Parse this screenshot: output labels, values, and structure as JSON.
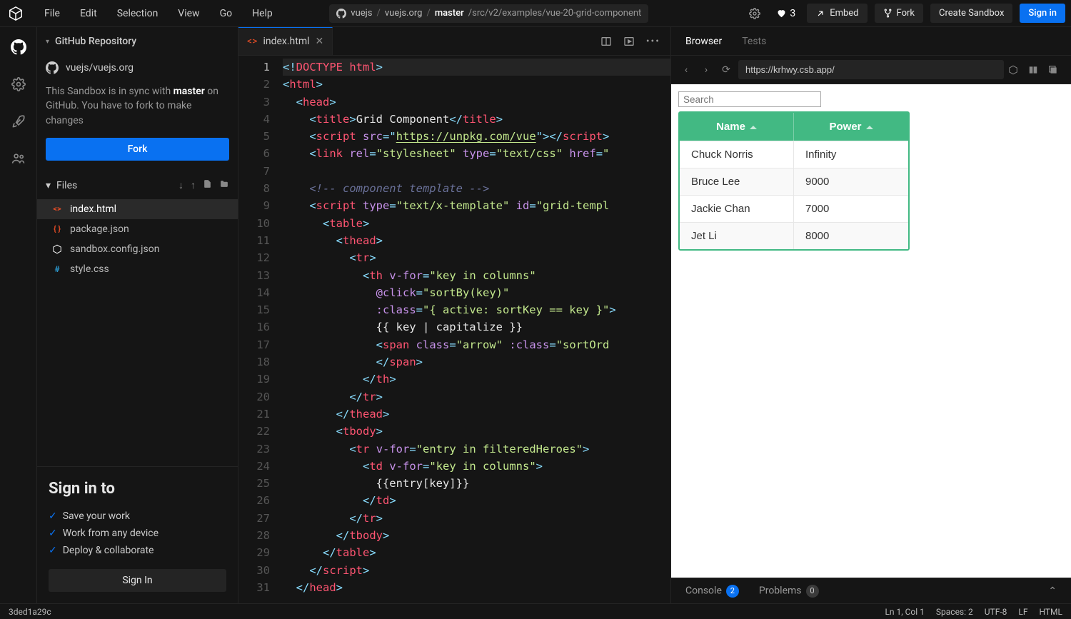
{
  "menubar": {
    "menus": [
      "File",
      "Edit",
      "Selection",
      "View",
      "Go",
      "Help"
    ],
    "breadcrumb": {
      "owner": "vuejs",
      "repo": "vuejs.org",
      "branch": "master",
      "path": "/src/v2/examples/vue-20-grid-component"
    },
    "likes": "3",
    "embed": "Embed",
    "fork": "Fork",
    "create": "Create Sandbox",
    "signin": "Sign in"
  },
  "sidebar": {
    "title": "GitHub Repository",
    "repo": "vuejs/vuejs.org",
    "sync_msg_pre": "This Sandbox is in sync with ",
    "sync_msg_bold": "master",
    "sync_msg_post": " on GitHub. You have to fork to make changes",
    "fork": "Fork",
    "files_title": "Files",
    "files": [
      {
        "name": "index.html",
        "icon": "orange",
        "active": true
      },
      {
        "name": "package.json",
        "icon": "json",
        "active": false
      },
      {
        "name": "sandbox.config.json",
        "icon": "cfg",
        "active": false
      },
      {
        "name": "style.css",
        "icon": "css",
        "active": false
      }
    ],
    "signin": {
      "title": "Sign in to",
      "benefits": [
        "Save your work",
        "Work from any device",
        "Deploy & collaborate"
      ],
      "button": "Sign In"
    }
  },
  "tabs": {
    "active": "index.html"
  },
  "editor": {
    "lines": 31
  },
  "preview": {
    "tabs": [
      "Browser",
      "Tests"
    ],
    "url": "https://krhwy.csb.app/",
    "search_placeholder": "Search",
    "table": {
      "headers": [
        "Name",
        "Power"
      ],
      "rows": [
        {
          "name": "Chuck Norris",
          "power": "Infinity"
        },
        {
          "name": "Bruce Lee",
          "power": "9000"
        },
        {
          "name": "Jackie Chan",
          "power": "7000"
        },
        {
          "name": "Jet Li",
          "power": "8000"
        }
      ]
    },
    "console_label": "Console",
    "console_badge": "2",
    "problems_label": "Problems",
    "problems_badge": "0"
  },
  "statusbar": {
    "left": "3ded1a29c",
    "right": [
      "Ln 1, Col 1",
      "Spaces: 2",
      "UTF-8",
      "LF",
      "HTML"
    ]
  }
}
